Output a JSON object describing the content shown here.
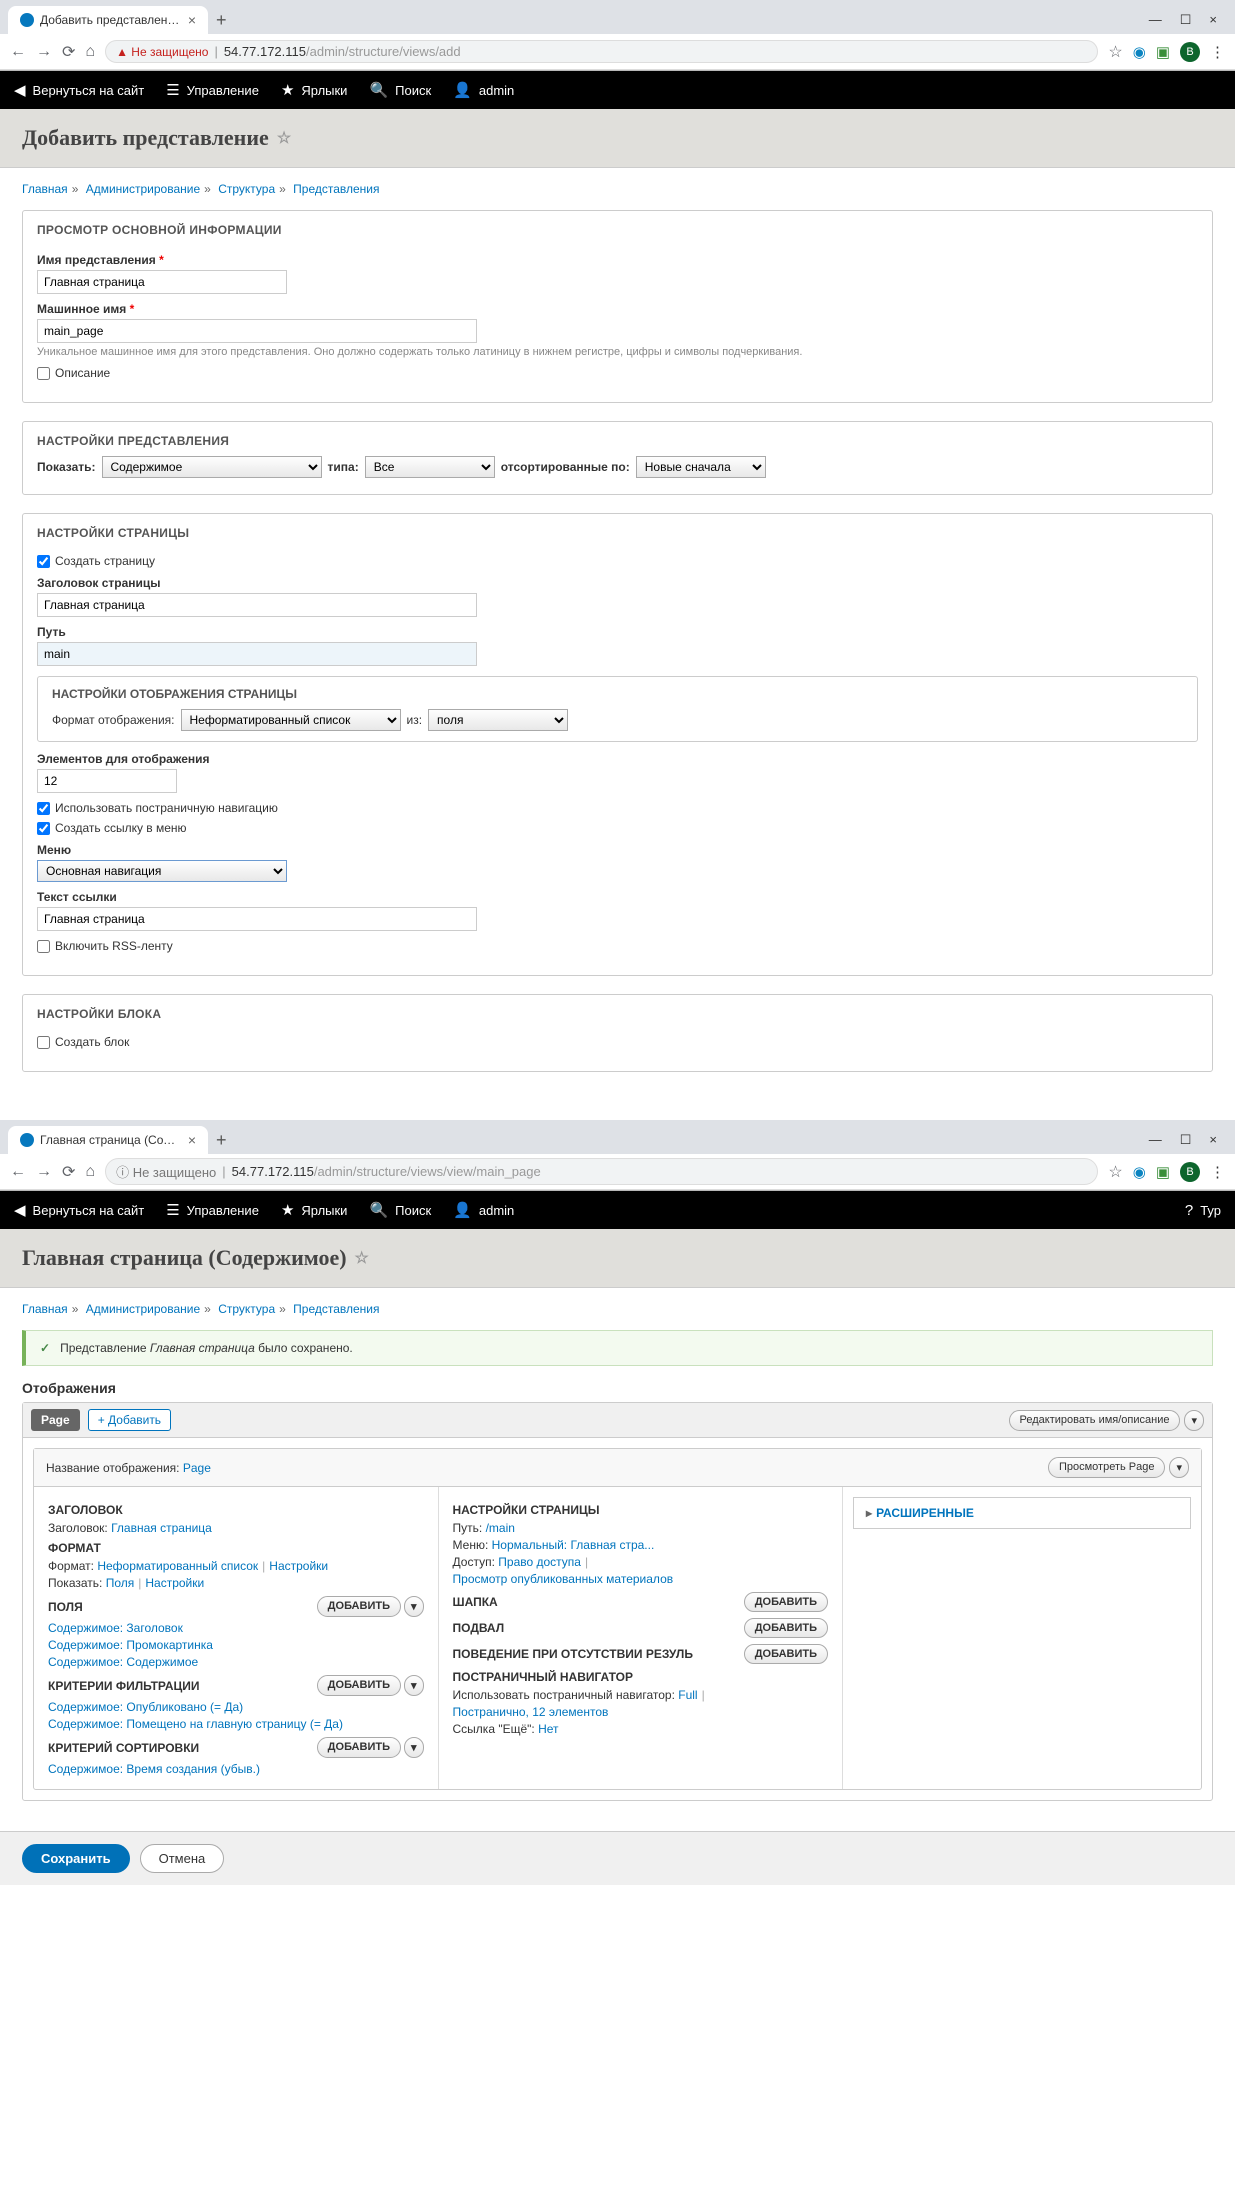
{
  "screen1": {
    "tab_title": "Добавить представление | Sys…",
    "insecure": "Не защищено",
    "url_host": "54.77.172.115",
    "url_path": "/admin/structure/views/add",
    "toolbar": {
      "back": "Вернуться на сайт",
      "manage": "Управление",
      "shortcuts": "Ярлыки",
      "search": "Поиск",
      "user": "admin"
    },
    "title": "Добавить представление",
    "breadcrumb": [
      "Главная",
      "Администрирование",
      "Структура",
      "Представления"
    ],
    "basic": {
      "legend": "ПРОСМОТР ОСНОВНОЙ ИНФОРМАЦИИ",
      "name_label": "Имя представления",
      "name_value": "Главная страница",
      "machine_label": "Машинное имя",
      "machine_value": "main_page",
      "machine_help": "Уникальное машинное имя для этого представления. Оно должно содержать только латиницу в нижнем регистре, цифры и символы подчеркивания.",
      "desc_label": "Описание"
    },
    "view_settings": {
      "legend": "НАСТРОЙКИ ПРЕДСТАВЛЕНИЯ",
      "show": "Показать:",
      "show_val": "Содержимое",
      "type": "типа:",
      "type_val": "Все",
      "sorted": "отсортированные по:",
      "sorted_val": "Новые сначала"
    },
    "page_settings": {
      "legend": "НАСТРОЙКИ СТРАНИЦЫ",
      "create_page": "Создать страницу",
      "ptitle_label": "Заголовок страницы",
      "ptitle_value": "Главная страница",
      "path_label": "Путь",
      "path_value": "main",
      "display_legend": "НАСТРОЙКИ ОТОБРАЖЕНИЯ СТРАНИЦЫ",
      "format_label": "Формат отображения:",
      "format_val": "Неформатированный список",
      "of": "из:",
      "of_val": "поля",
      "items_label": "Элементов для отображения",
      "items_value": "12",
      "use_pager": "Использовать постраничную навигацию",
      "create_menu": "Создать ссылку в меню",
      "menu_label": "Меню",
      "menu_val": "Основная навигация",
      "link_text_label": "Текст ссылки",
      "link_text_value": "Главная страница",
      "rss": "Включить RSS-ленту"
    },
    "block_settings": {
      "legend": "НАСТРОЙКИ БЛОКА",
      "create_block": "Создать блок"
    }
  },
  "screen2": {
    "tab_title": "Главная страница (Содержимо…",
    "insecure": "Не защищено",
    "url_host": "54.77.172.115",
    "url_path": "/admin/structure/views/view/main_page",
    "toolbar": {
      "back": "Вернуться на сайт",
      "manage": "Управление",
      "shortcuts": "Ярлыки",
      "search": "Поиск",
      "user": "admin",
      "tour": "Тур"
    },
    "title": "Главная страница (Содержимое)",
    "breadcrumb": [
      "Главная",
      "Администрирование",
      "Структура",
      "Представления"
    ],
    "success_prefix": "Представление ",
    "success_em": "Главная страница",
    "success_suffix": " было сохранено.",
    "displays": "Отображения",
    "tab_page": "Page",
    "add": "+ Добавить",
    "edit_name": "Редактировать имя/описание",
    "display_name_label": "Название отображения:",
    "display_name_value": "Page",
    "preview": "Просмотреть Page",
    "col1": {
      "title_h": "ЗАГОЛОВОК",
      "title_lbl": "Заголовок:",
      "title_val": "Главная страница",
      "format_h": "ФОРМАТ",
      "format_lbl": "Формат:",
      "format_val": "Неформатированный список",
      "format_set": "Настройки",
      "show_lbl": "Показать:",
      "show_val": "Поля",
      "show_set": "Настройки",
      "fields_h": "ПОЛЯ",
      "add_btn": "Добавить",
      "f1": "Содержимое: Заголовок",
      "f2": "Содержимое: Промокартинка",
      "f3": "Содержимое: Содержимое",
      "filter_h": "КРИТЕРИИ ФИЛЬТРАЦИИ",
      "fl1": "Содержимое: Опубликовано (= Да)",
      "fl2": "Содержимое: Помещено на главную страницу (= Да)",
      "sort_h": "КРИТЕРИЙ СОРТИРОВКИ",
      "s1": "Содержимое: Время создания (убыв.)"
    },
    "col2": {
      "ps_h": "НАСТРОЙКИ СТРАНИЦЫ",
      "path_lbl": "Путь:",
      "path_val": "/main",
      "menu_lbl": "Меню:",
      "menu_val": "Нормальный: Главная стра...",
      "access_lbl": "Доступ:",
      "access_val": "Право доступа",
      "access_link": "Просмотр опубликованных материалов",
      "header_h": "ШАПКА",
      "footer_h": "ПОДВАЛ",
      "empty_h": "ПОВЕДЕНИЕ ПРИ ОТСУТСТВИИ РЕЗУЛЬ",
      "pager_h": "ПОСТРАНИЧНЫЙ НАВИГАТОР",
      "pager_lbl": "Использовать постраничный навигатор:",
      "pager_val": "Full",
      "pager_det": "Постранично, 12 элементов",
      "more_lbl": "Ссылка \"Ещё\":",
      "more_val": "Нет",
      "add_btn": "Добавить"
    },
    "col3": {
      "advanced": "РАСШИРЕННЫЕ"
    },
    "save": "Сохранить",
    "cancel": "Отмена"
  }
}
